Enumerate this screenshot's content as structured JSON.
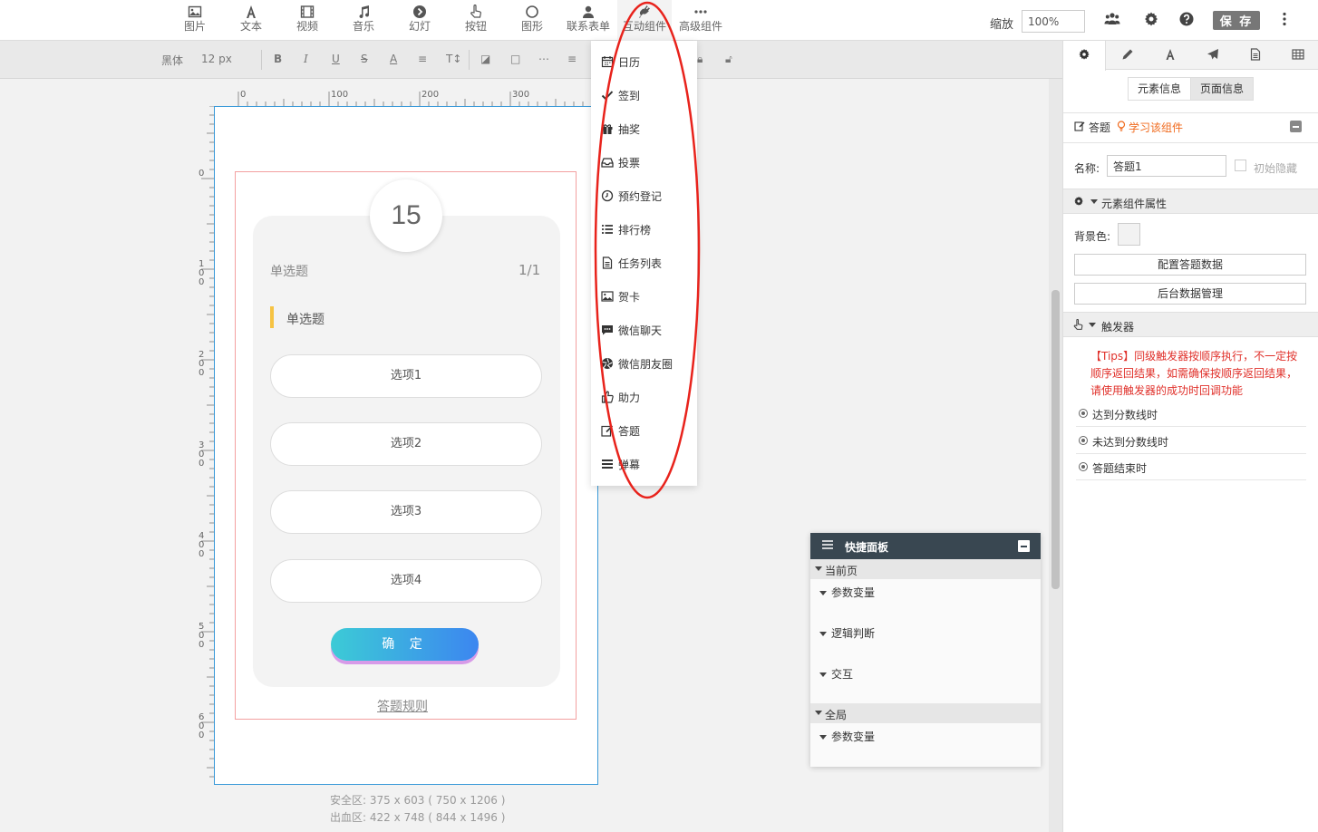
{
  "toolbar": {
    "items": [
      {
        "label": "图片",
        "icon": "image-icon"
      },
      {
        "label": "文本",
        "icon": "text-icon"
      },
      {
        "label": "视频",
        "icon": "video-icon"
      },
      {
        "label": "音乐",
        "icon": "music-icon"
      },
      {
        "label": "幻灯",
        "icon": "slideshow-icon"
      },
      {
        "label": "按钮",
        "icon": "hand-pointer-icon"
      },
      {
        "label": "图形",
        "icon": "circle-shape-icon"
      },
      {
        "label": "联系表单",
        "icon": "user-icon"
      },
      {
        "label": "互动组件",
        "icon": "plug-icon"
      },
      {
        "label": "高级组件",
        "icon": "more-icon"
      }
    ],
    "zoom_label": "缩放",
    "zoom_value": "100%",
    "save_label": "保 存"
  },
  "format_bar": {
    "font_family": "黑体",
    "font_size": "12 px"
  },
  "interactive_menu": {
    "items": [
      {
        "label": "日历",
        "icon": "calendar-icon"
      },
      {
        "label": "签到",
        "icon": "check-icon"
      },
      {
        "label": "抽奖",
        "icon": "gift-icon"
      },
      {
        "label": "投票",
        "icon": "inbox-icon"
      },
      {
        "label": "预约登记",
        "icon": "clock-icon"
      },
      {
        "label": "排行榜",
        "icon": "list-icon"
      },
      {
        "label": "任务列表",
        "icon": "document-icon"
      },
      {
        "label": "贺卡",
        "icon": "picture-icon"
      },
      {
        "label": "微信聊天",
        "icon": "chat-icon"
      },
      {
        "label": "微信朋友圈",
        "icon": "aperture-icon"
      },
      {
        "label": "助力",
        "icon": "thumbs-up-icon"
      },
      {
        "label": "答题",
        "icon": "edit-icon"
      },
      {
        "label": "弹幕",
        "icon": "bars-icon"
      }
    ]
  },
  "canvas": {
    "ruler_top_labels": [
      "0",
      "100",
      "200",
      "300"
    ],
    "ruler_left_labels": [
      "0",
      "100",
      "200",
      "300",
      "400",
      "500",
      "600"
    ],
    "timer": "15",
    "question_type": "单选题",
    "question_count": "1/1",
    "question_title": "单选题",
    "options": [
      "选项1",
      "选项2",
      "选项3",
      "选项4"
    ],
    "confirm_label": "确 定",
    "rules_label": "答题规则",
    "safe_area": "安全区: 375 x 603 ( 750 x 1206 )",
    "bleed_area": "出血区: 422 x 748 ( 844 x 1496 )"
  },
  "right_panel": {
    "seg_element": "元素信息",
    "seg_page": "页面信息",
    "component_name": "答题",
    "learn_link": "学习该组件",
    "name_label": "名称:",
    "name_value": "答题1",
    "hide_label": "初始隐藏",
    "props_section": "元素组件属性",
    "bg_label": "背景色:",
    "config_btn": "配置答题数据",
    "backend_btn": "后台数据管理",
    "trigger_section": "触发器",
    "tips": "【Tips】同级触发器按顺序执行，不一定按顺序返回结果，如需确保按顺序返回结果，请使用触发器的成功时回调功能",
    "triggers": [
      "达到分数线时",
      "未达到分数线时",
      "答题结束时"
    ]
  },
  "quick_panel": {
    "title": "快捷面板",
    "current_page": "当前页",
    "current_items": [
      "参数变量",
      "逻辑判断",
      "交互"
    ],
    "global": "全局",
    "global_items": [
      "参数变量"
    ]
  },
  "colors": {
    "annotation_red": "#e8231c",
    "stage_border": "#3a9ad9",
    "confirm_gradient_start": "#3ccbd6",
    "confirm_gradient_end": "#3c86f0",
    "tips_red": "#e0302a",
    "quick_panel_header": "#394751"
  }
}
